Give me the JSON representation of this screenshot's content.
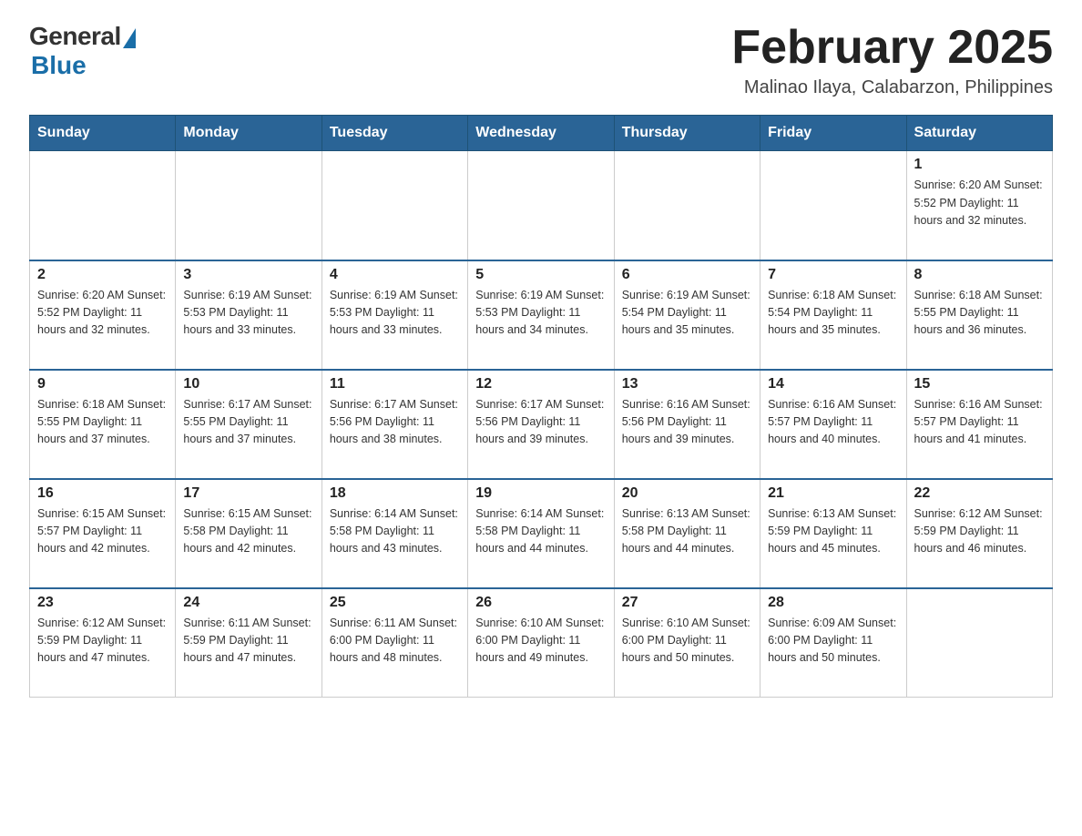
{
  "header": {
    "logo_general": "General",
    "logo_blue": "Blue",
    "month_title": "February 2025",
    "location": "Malinao Ilaya, Calabarzon, Philippines"
  },
  "days_of_week": [
    "Sunday",
    "Monday",
    "Tuesday",
    "Wednesday",
    "Thursday",
    "Friday",
    "Saturday"
  ],
  "weeks": [
    [
      {
        "day": "",
        "info": ""
      },
      {
        "day": "",
        "info": ""
      },
      {
        "day": "",
        "info": ""
      },
      {
        "day": "",
        "info": ""
      },
      {
        "day": "",
        "info": ""
      },
      {
        "day": "",
        "info": ""
      },
      {
        "day": "1",
        "info": "Sunrise: 6:20 AM\nSunset: 5:52 PM\nDaylight: 11 hours and 32 minutes."
      }
    ],
    [
      {
        "day": "2",
        "info": "Sunrise: 6:20 AM\nSunset: 5:52 PM\nDaylight: 11 hours and 32 minutes."
      },
      {
        "day": "3",
        "info": "Sunrise: 6:19 AM\nSunset: 5:53 PM\nDaylight: 11 hours and 33 minutes."
      },
      {
        "day": "4",
        "info": "Sunrise: 6:19 AM\nSunset: 5:53 PM\nDaylight: 11 hours and 33 minutes."
      },
      {
        "day": "5",
        "info": "Sunrise: 6:19 AM\nSunset: 5:53 PM\nDaylight: 11 hours and 34 minutes."
      },
      {
        "day": "6",
        "info": "Sunrise: 6:19 AM\nSunset: 5:54 PM\nDaylight: 11 hours and 35 minutes."
      },
      {
        "day": "7",
        "info": "Sunrise: 6:18 AM\nSunset: 5:54 PM\nDaylight: 11 hours and 35 minutes."
      },
      {
        "day": "8",
        "info": "Sunrise: 6:18 AM\nSunset: 5:55 PM\nDaylight: 11 hours and 36 minutes."
      }
    ],
    [
      {
        "day": "9",
        "info": "Sunrise: 6:18 AM\nSunset: 5:55 PM\nDaylight: 11 hours and 37 minutes."
      },
      {
        "day": "10",
        "info": "Sunrise: 6:17 AM\nSunset: 5:55 PM\nDaylight: 11 hours and 37 minutes."
      },
      {
        "day": "11",
        "info": "Sunrise: 6:17 AM\nSunset: 5:56 PM\nDaylight: 11 hours and 38 minutes."
      },
      {
        "day": "12",
        "info": "Sunrise: 6:17 AM\nSunset: 5:56 PM\nDaylight: 11 hours and 39 minutes."
      },
      {
        "day": "13",
        "info": "Sunrise: 6:16 AM\nSunset: 5:56 PM\nDaylight: 11 hours and 39 minutes."
      },
      {
        "day": "14",
        "info": "Sunrise: 6:16 AM\nSunset: 5:57 PM\nDaylight: 11 hours and 40 minutes."
      },
      {
        "day": "15",
        "info": "Sunrise: 6:16 AM\nSunset: 5:57 PM\nDaylight: 11 hours and 41 minutes."
      }
    ],
    [
      {
        "day": "16",
        "info": "Sunrise: 6:15 AM\nSunset: 5:57 PM\nDaylight: 11 hours and 42 minutes."
      },
      {
        "day": "17",
        "info": "Sunrise: 6:15 AM\nSunset: 5:58 PM\nDaylight: 11 hours and 42 minutes."
      },
      {
        "day": "18",
        "info": "Sunrise: 6:14 AM\nSunset: 5:58 PM\nDaylight: 11 hours and 43 minutes."
      },
      {
        "day": "19",
        "info": "Sunrise: 6:14 AM\nSunset: 5:58 PM\nDaylight: 11 hours and 44 minutes."
      },
      {
        "day": "20",
        "info": "Sunrise: 6:13 AM\nSunset: 5:58 PM\nDaylight: 11 hours and 44 minutes."
      },
      {
        "day": "21",
        "info": "Sunrise: 6:13 AM\nSunset: 5:59 PM\nDaylight: 11 hours and 45 minutes."
      },
      {
        "day": "22",
        "info": "Sunrise: 6:12 AM\nSunset: 5:59 PM\nDaylight: 11 hours and 46 minutes."
      }
    ],
    [
      {
        "day": "23",
        "info": "Sunrise: 6:12 AM\nSunset: 5:59 PM\nDaylight: 11 hours and 47 minutes."
      },
      {
        "day": "24",
        "info": "Sunrise: 6:11 AM\nSunset: 5:59 PM\nDaylight: 11 hours and 47 minutes."
      },
      {
        "day": "25",
        "info": "Sunrise: 6:11 AM\nSunset: 6:00 PM\nDaylight: 11 hours and 48 minutes."
      },
      {
        "day": "26",
        "info": "Sunrise: 6:10 AM\nSunset: 6:00 PM\nDaylight: 11 hours and 49 minutes."
      },
      {
        "day": "27",
        "info": "Sunrise: 6:10 AM\nSunset: 6:00 PM\nDaylight: 11 hours and 50 minutes."
      },
      {
        "day": "28",
        "info": "Sunrise: 6:09 AM\nSunset: 6:00 PM\nDaylight: 11 hours and 50 minutes."
      },
      {
        "day": "",
        "info": ""
      }
    ]
  ]
}
